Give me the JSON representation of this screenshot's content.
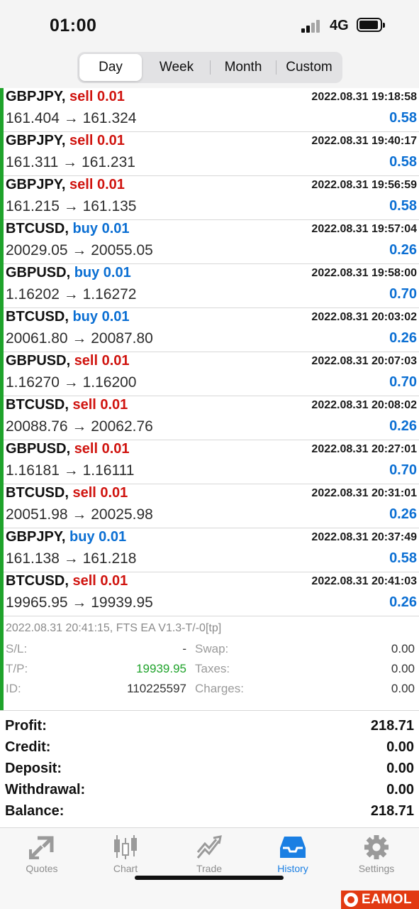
{
  "status_bar": {
    "time": "01:00",
    "network": "4G"
  },
  "period_tabs": [
    {
      "label": "Day",
      "active": true
    },
    {
      "label": "Week",
      "active": false
    },
    {
      "label": "Month",
      "active": false
    },
    {
      "label": "Custom",
      "active": false
    }
  ],
  "trades": [
    {
      "symbol": "GBPJPY,",
      "side": "sell 0.01",
      "type": "sell",
      "datetime": "2022.08.31 19:18:58",
      "prices": "161.404 → 161.324",
      "profit": "0.58"
    },
    {
      "symbol": "GBPJPY,",
      "side": "sell 0.01",
      "type": "sell",
      "datetime": "2022.08.31 19:40:17",
      "prices": "161.311 → 161.231",
      "profit": "0.58"
    },
    {
      "symbol": "GBPJPY,",
      "side": "sell 0.01",
      "type": "sell",
      "datetime": "2022.08.31 19:56:59",
      "prices": "161.215 → 161.135",
      "profit": "0.58"
    },
    {
      "symbol": "BTCUSD,",
      "side": "buy 0.01",
      "type": "buy",
      "datetime": "2022.08.31 19:57:04",
      "prices": "20029.05 → 20055.05",
      "profit": "0.26"
    },
    {
      "symbol": "GBPUSD,",
      "side": "buy 0.01",
      "type": "buy",
      "datetime": "2022.08.31 19:58:00",
      "prices": "1.16202 → 1.16272",
      "profit": "0.70"
    },
    {
      "symbol": "BTCUSD,",
      "side": "buy 0.01",
      "type": "buy",
      "datetime": "2022.08.31 20:03:02",
      "prices": "20061.80 → 20087.80",
      "profit": "0.26"
    },
    {
      "symbol": "GBPUSD,",
      "side": "sell 0.01",
      "type": "sell",
      "datetime": "2022.08.31 20:07:03",
      "prices": "1.16270 → 1.16200",
      "profit": "0.70"
    },
    {
      "symbol": "BTCUSD,",
      "side": "sell 0.01",
      "type": "sell",
      "datetime": "2022.08.31 20:08:02",
      "prices": "20088.76 → 20062.76",
      "profit": "0.26"
    },
    {
      "symbol": "GBPUSD,",
      "side": "sell 0.01",
      "type": "sell",
      "datetime": "2022.08.31 20:27:01",
      "prices": "1.16181 → 1.16111",
      "profit": "0.70"
    },
    {
      "symbol": "BTCUSD,",
      "side": "sell 0.01",
      "type": "sell",
      "datetime": "2022.08.31 20:31:01",
      "prices": "20051.98 → 20025.98",
      "profit": "0.26"
    },
    {
      "symbol": "GBPJPY,",
      "side": "buy 0.01",
      "type": "buy",
      "datetime": "2022.08.31 20:37:49",
      "prices": "161.138 → 161.218",
      "profit": "0.58"
    },
    {
      "symbol": "BTCUSD,",
      "side": "sell 0.01",
      "type": "sell",
      "datetime": "2022.08.31 20:41:03",
      "prices": "19965.95 → 19939.95",
      "profit": "0.26"
    }
  ],
  "detail": {
    "comment": "2022.08.31 20:41:15, FTS EA V1.3-T/-0[tp]",
    "sl_label": "S/L:",
    "sl_value": "-",
    "tp_label": "T/P:",
    "tp_value": "19939.95",
    "id_label": "ID:",
    "id_value": "110225597",
    "swap_label": "Swap:",
    "swap_value": "0.00",
    "taxes_label": "Taxes:",
    "taxes_value": "0.00",
    "charges_label": "Charges:",
    "charges_value": "0.00"
  },
  "summary": [
    {
      "label": "Profit:",
      "value": "218.71"
    },
    {
      "label": "Credit:",
      "value": "0.00"
    },
    {
      "label": "Deposit:",
      "value": "0.00"
    },
    {
      "label": "Withdrawal:",
      "value": "0.00"
    },
    {
      "label": "Balance:",
      "value": "218.71"
    }
  ],
  "tab_bar": [
    {
      "label": "Quotes",
      "icon": "quotes-icon",
      "active": false
    },
    {
      "label": "Chart",
      "icon": "chart-icon",
      "active": false
    },
    {
      "label": "Trade",
      "icon": "trade-icon",
      "active": false
    },
    {
      "label": "History",
      "icon": "history-icon",
      "active": true
    },
    {
      "label": "Settings",
      "icon": "gear-icon",
      "active": false
    }
  ],
  "colors": {
    "sell": "#d0140f",
    "buy": "#0b6fd3",
    "profit": "#0b6fd3",
    "accent_green": "#1fa32b",
    "tab_active": "#1a7fe3"
  },
  "watermark": {
    "text": "EAMOL"
  }
}
